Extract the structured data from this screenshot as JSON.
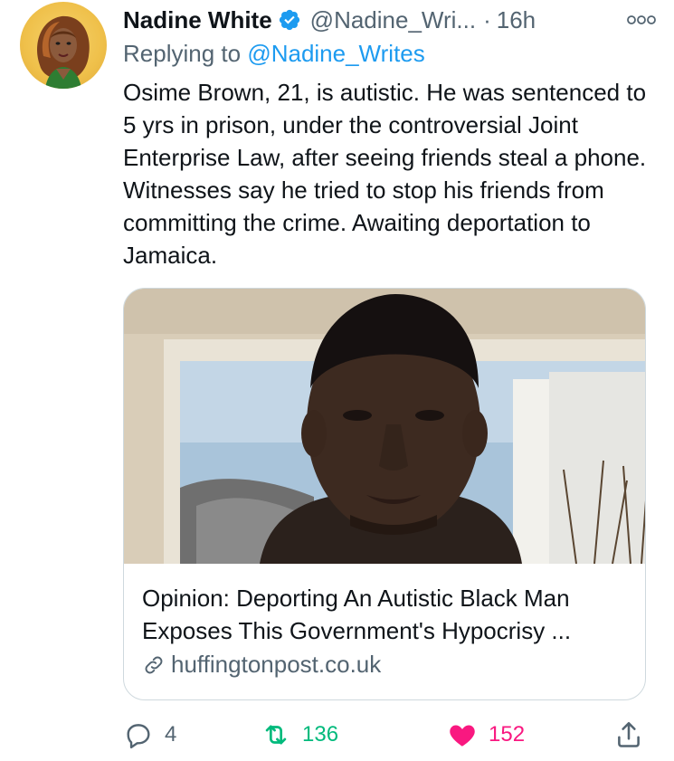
{
  "tweet": {
    "author": {
      "display_name": "Nadine White",
      "handle": "@Nadine_Wri...",
      "verified": true
    },
    "time": "16h",
    "separator": "·",
    "reply_prefix": "Replying to",
    "reply_to": "@Nadine_Writes",
    "text": "Osime Brown, 21, is autistic. He was sentenced to 5 yrs in prison, under the controversial Joint Enterprise Law, after seeing friends steal a phone. Witnesses say he tried to stop his friends from committing the crime. Awaiting deportation to Jamaica.",
    "card": {
      "title": "Opinion: Deporting An Autistic Black Man Exposes This Government's Hypocrisy ...",
      "domain": "huffingtonpost.co.uk"
    },
    "actions": {
      "replies": "4",
      "retweets": "136",
      "likes": "152"
    }
  },
  "colors": {
    "accent": "#1d9bf0",
    "retweet": "#00ba7c",
    "like": "#f91880",
    "secondary_text": "#536471"
  },
  "icons": [
    "verified-badge-icon",
    "more-options-icon",
    "link-icon",
    "reply-icon",
    "retweet-icon",
    "like-heart-icon",
    "share-icon"
  ]
}
